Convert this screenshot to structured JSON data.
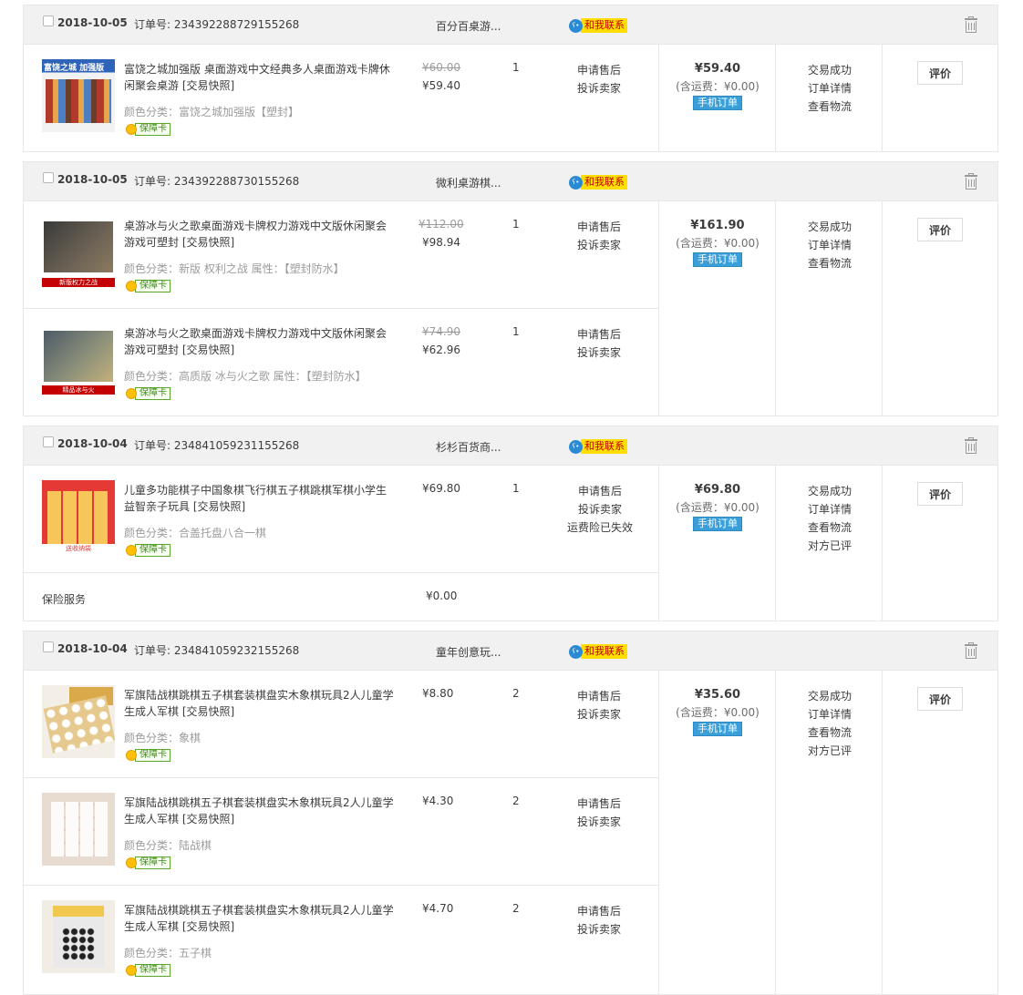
{
  "orders": [
    {
      "date": "2018-10-05",
      "order_no": "订单号: 234392288729155268",
      "shop": "百分百桌游...",
      "contact": "和我联系",
      "items": [
        {
          "title": "富饶之城加强版 桌面游戏中文经典多人桌面游戏卡牌休闲聚会桌游 [交易快照]",
          "sku": "颜色分类：富饶之城加强版【塑封】",
          "thumb_caption": "富饶之城 加强版",
          "badge": "保障卡",
          "original_price": "¥60.00",
          "price": "¥59.40",
          "qty": "1",
          "service": [
            "申请售后",
            "投诉卖家"
          ]
        }
      ],
      "total": "¥59.40",
      "shipping": "(含运费：¥0.00)",
      "mobile_tag": "手机订单",
      "status": [
        "交易成功",
        "订单详情",
        "查看物流"
      ],
      "action": "评价"
    },
    {
      "date": "2018-10-05",
      "order_no": "订单号: 234392288730155268",
      "shop": "微利桌游棋...",
      "contact": "和我联系",
      "items": [
        {
          "title": "桌游冰与火之歌桌面游戏卡牌权力游戏中文版休闲聚会游戏可塑封 [交易快照]",
          "sku": "颜色分类：新版 权利之战   属性：【塑封防水】",
          "thumb_caption": "新版权力之战",
          "badge": "保障卡",
          "original_price": "¥112.00",
          "price": "¥98.94",
          "qty": "1",
          "service": [
            "申请售后",
            "投诉卖家"
          ]
        },
        {
          "title": "桌游冰与火之歌桌面游戏卡牌权力游戏中文版休闲聚会游戏可塑封 [交易快照]",
          "sku": "颜色分类：高质版 冰与火之歌   属性：【塑封防水】",
          "thumb_caption": "精品冰与火",
          "badge": "保障卡",
          "original_price": "¥74.90",
          "price": "¥62.96",
          "qty": "1",
          "service": [
            "申请售后",
            "投诉卖家"
          ]
        }
      ],
      "total": "¥161.90",
      "shipping": "(含运费：¥0.00)",
      "mobile_tag": "手机订单",
      "status": [
        "交易成功",
        "订单详情",
        "查看物流"
      ],
      "action": "评价"
    },
    {
      "date": "2018-10-04",
      "order_no": "订单号: 234841059231155268",
      "shop": "杉杉百货商...",
      "contact": "和我联系",
      "items": [
        {
          "title": "儿童多功能棋子中国象棋飞行棋五子棋跳棋军棋小学生益智亲子玩具 [交易快照]",
          "sku": "颜色分类：合盖托盘八合一棋",
          "thumb_caption": "送收纳袋",
          "badge": "保障卡",
          "price": "¥69.80",
          "qty": "1",
          "service": [
            "申请售后",
            "投诉卖家",
            "运费险已失效"
          ]
        }
      ],
      "insurance": {
        "label": "保险服务",
        "price": "¥0.00"
      },
      "total": "¥69.80",
      "shipping": "(含运费：¥0.00)",
      "mobile_tag": "手机订单",
      "status": [
        "交易成功",
        "订单详情",
        "查看物流",
        "对方已评"
      ],
      "action": "评价"
    },
    {
      "date": "2018-10-04",
      "order_no": "订单号: 234841059232155268",
      "shop": "童年创意玩...",
      "contact": "和我联系",
      "items": [
        {
          "title": "军旗陆战棋跳棋五子棋套装棋盘实木象棋玩具2人儿童学生成人军棋 [交易快照]",
          "sku": "颜色分类：象棋",
          "badge": "保障卡",
          "price": "¥8.80",
          "qty": "2",
          "service": [
            "申请售后",
            "投诉卖家"
          ]
        },
        {
          "title": "军旗陆战棋跳棋五子棋套装棋盘实木象棋玩具2人儿童学生成人军棋 [交易快照]",
          "sku": "颜色分类：陆战棋",
          "badge": "保障卡",
          "price": "¥4.30",
          "qty": "2",
          "service": [
            "申请售后",
            "投诉卖家"
          ]
        },
        {
          "title": "军旗陆战棋跳棋五子棋套装棋盘实木象棋玩具2人儿童学生成人军棋 [交易快照]",
          "sku": "颜色分类：五子棋",
          "badge": "保障卡",
          "price": "¥4.70",
          "qty": "2",
          "service": [
            "申请售后",
            "投诉卖家"
          ]
        }
      ],
      "total": "¥35.60",
      "shipping": "(含运费：¥0.00)",
      "mobile_tag": "手机订单",
      "status": [
        "交易成功",
        "订单详情",
        "查看物流",
        "对方已评"
      ],
      "action": "评价"
    }
  ],
  "colors": {
    "header_bg": "#f1f1f1",
    "contact_bg": "#ffde00",
    "contact_text": "#c40000",
    "mobile_tag": "#3a9fd8",
    "badge_green": "#5aa72c"
  },
  "icons": [
    "checkbox-icon",
    "wangwang-icon",
    "trash-icon",
    "shield-icon"
  ]
}
